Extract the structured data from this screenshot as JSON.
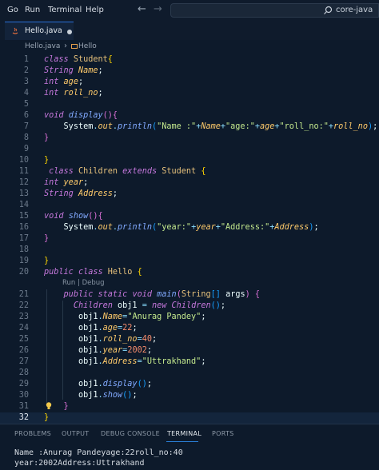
{
  "menu": {
    "items": [
      "Go",
      "Run",
      "Terminal",
      "Help"
    ]
  },
  "search": {
    "text": "core-java"
  },
  "tab": {
    "label": "Hello.java"
  },
  "breadcrumb": {
    "file": "Hello.java",
    "symbol": "Hello"
  },
  "editor": {
    "line_numbers": [
      "1",
      "2",
      "3",
      "4",
      "5",
      "6",
      "7",
      "8",
      "9",
      "10",
      "11",
      "12",
      "13",
      "14",
      "15",
      "16",
      "17",
      "18",
      "19",
      "20",
      "21",
      "22",
      "23",
      "24",
      "25",
      "26",
      "27",
      "28",
      "29",
      "30",
      "31",
      "32"
    ],
    "codelens": "Run | Debug",
    "current_line": "32"
  },
  "panel": {
    "tabs": [
      "PROBLEMS",
      "OUTPUT",
      "DEBUG CONSOLE",
      "TERMINAL",
      "PORTS"
    ],
    "active_tab": "TERMINAL"
  },
  "terminal": {
    "lines": [
      "Name :Anurag Pandeyage:22roll_no:40",
      "year:2002Address:Uttrakhand"
    ]
  },
  "colors": {
    "background": "#0d1a2b",
    "accent": "#2a7fd6"
  }
}
